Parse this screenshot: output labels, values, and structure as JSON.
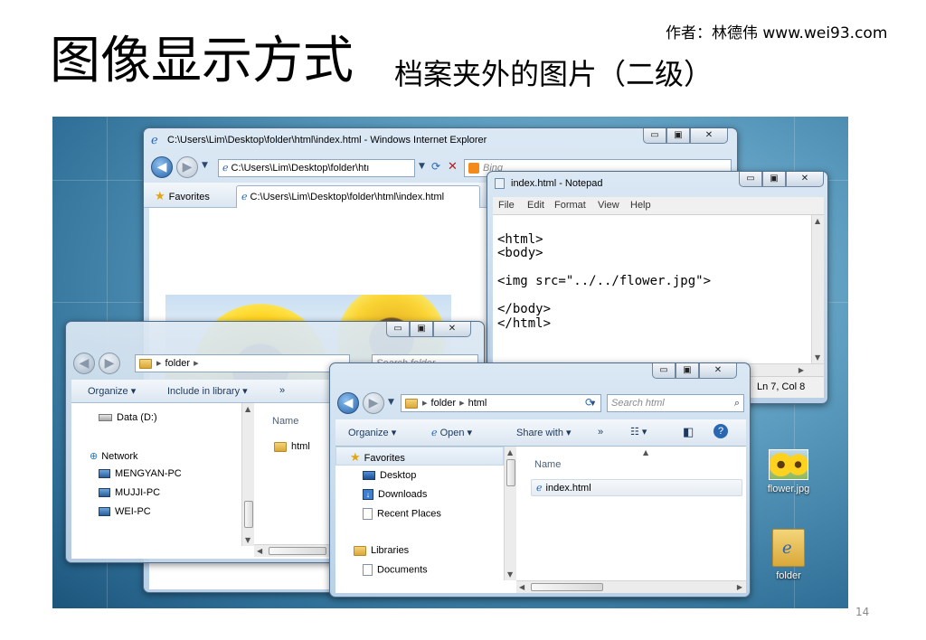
{
  "slide": {
    "author": "作者：林德伟 www.wei93.com",
    "title": "图像显示方式",
    "subtitle": "档案夹外的图片（二级）",
    "page_number": "14"
  },
  "caption_buttons": {
    "minimize": "▭",
    "maximize": "▣",
    "close": "✕"
  },
  "ie": {
    "window_title": "C:\\Users\\Lim\\Desktop\\folder\\html\\index.html - Windows Internet Explorer",
    "address": "C:\\Users\\Lim\\Desktop\\folder\\htı",
    "search_placeholder": "Bing",
    "favorites_label": "Favorites",
    "tab_title": "C:\\Users\\Lim\\Desktop\\folder\\html\\index.html"
  },
  "notepad": {
    "window_title": "index.html - Notepad",
    "menu": [
      "File",
      "Edit",
      "Format",
      "View",
      "Help"
    ],
    "lines": [
      "<html>",
      "<body>",
      "",
      "<img src=\"../../flower.jpg\">",
      "",
      "</body>",
      "</html>"
    ],
    "status": "Ln 7, Col 8"
  },
  "explorer_folder": {
    "breadcrumb": [
      "folder"
    ],
    "search_placeholder": "Search folder",
    "organize": "Organize",
    "include_in_library": "Include in library",
    "more": "»",
    "nav_items": [
      {
        "label": "Data (D:)",
        "icon": "drive-icon"
      },
      {
        "label": "Network",
        "icon": "network-icon"
      },
      {
        "label": "MENGYAN-PC",
        "icon": "computer-icon"
      },
      {
        "label": "MUJJI-PC",
        "icon": "computer-icon"
      },
      {
        "label": "WEI-PC",
        "icon": "computer-icon"
      }
    ],
    "column_name": "Name",
    "files": [
      "html"
    ]
  },
  "explorer_html": {
    "breadcrumb": [
      "folder",
      "html"
    ],
    "search_placeholder": "Search html",
    "organize": "Organize",
    "open": "Open",
    "share_with": "Share with",
    "more": "»",
    "nav_items": [
      {
        "label": "Favorites",
        "icon": "star-icon"
      },
      {
        "label": "Desktop",
        "icon": "desktop-icon"
      },
      {
        "label": "Downloads",
        "icon": "downloads-icon"
      },
      {
        "label": "Recent Places",
        "icon": "recent-places-icon"
      },
      {
        "label": "Libraries",
        "icon": "libraries-icon"
      },
      {
        "label": "Documents",
        "icon": "documents-icon"
      }
    ],
    "column_name": "Name",
    "files": [
      "index.html"
    ]
  },
  "desktop_icons": [
    {
      "label": "flower.jpg",
      "icon": "image-icon"
    },
    {
      "label": "folder",
      "icon": "folder-icon"
    }
  ]
}
